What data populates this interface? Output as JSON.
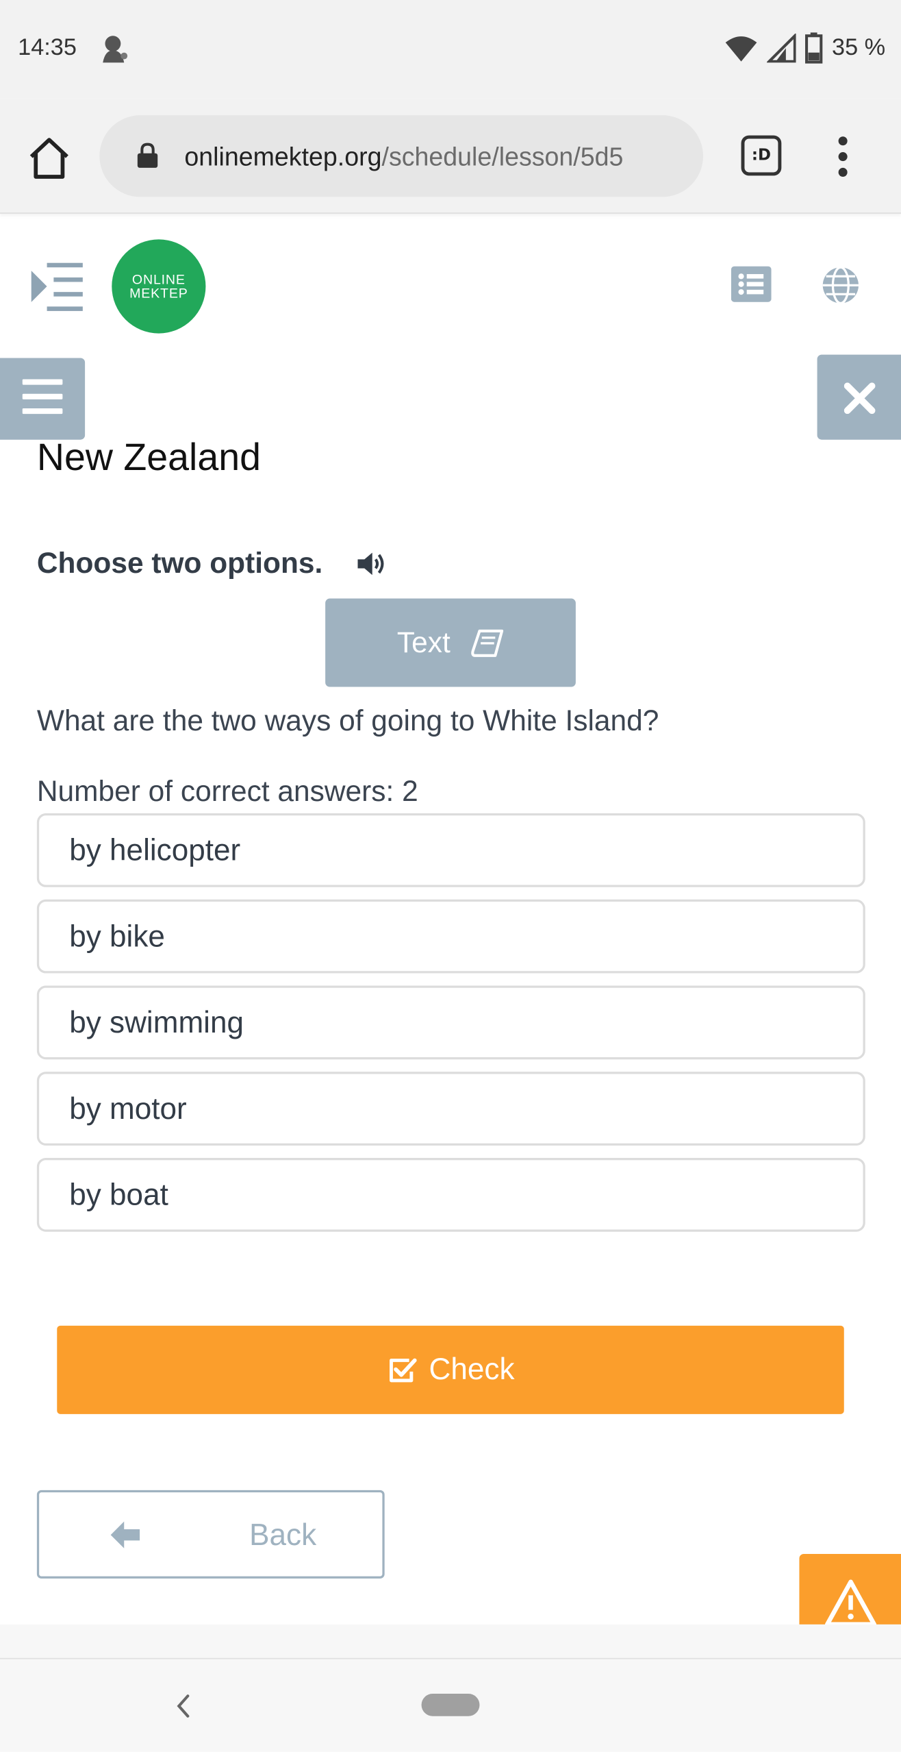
{
  "status_bar": {
    "time": "14:35",
    "battery": "35 %",
    "icons": [
      "notification-avatar-icon",
      "wifi-icon",
      "signal-icon",
      "battery-icon"
    ]
  },
  "browser": {
    "url_host": "onlinemektep.org",
    "url_path": "/schedule/lesson/5d5",
    "tab_switcher_label": ":D",
    "icons": [
      "home-icon",
      "lock-icon",
      "tab-switcher-icon",
      "more-vert-icon"
    ]
  },
  "header": {
    "logo_line1": "ONLINE",
    "logo_line2": "MEKTEP",
    "icons": [
      "sidebar-toggle-icon",
      "list-icon",
      "globe-icon"
    ]
  },
  "lesson": {
    "title": "New Zealand",
    "instruction": "Choose two options.",
    "text_button": "Text",
    "question": "What are the two ways of going to White Island?",
    "answer_count": "Number of correct answers: 2",
    "options": [
      "by helicopter",
      "by bike",
      "by swimming",
      "by motor",
      "by boat"
    ]
  },
  "actions": {
    "check": "Check",
    "back": "Back"
  },
  "colors": {
    "accent_orange": "#fb9e2c",
    "muted_blue_gray": "#9fb2c0",
    "logo_green": "#22a85a"
  }
}
